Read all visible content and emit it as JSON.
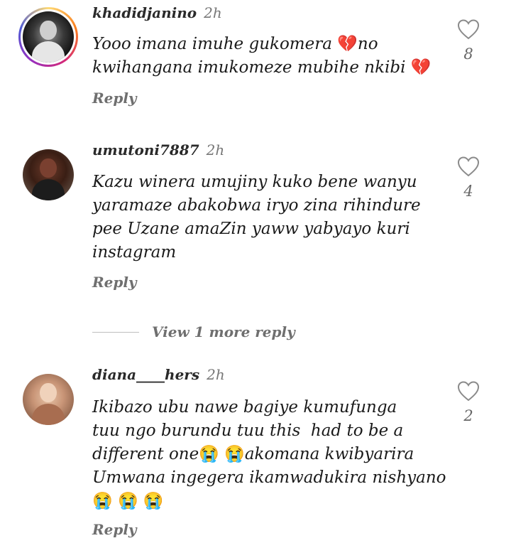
{
  "comments": [
    {
      "username": "khadidjanino",
      "time": "2h",
      "text_parts": [
        "Yooo imana imuhe gukomera ",
        "💔",
        "no\nkwihangana imukomeze mubihe nkibi ",
        "💔"
      ],
      "reply_label": "Reply",
      "likes": "8",
      "has_story_ring": true
    },
    {
      "username": "umutoni7887",
      "time": "2h",
      "text": "Kazu winera umujiny kuko bene wanyu\nyaramaze abakobwa iryo zina rihindure\npee Uzane amaZin yaww yabyayo kuri\ninstagram",
      "reply_label": "Reply",
      "likes": "4",
      "has_story_ring": false
    },
    {
      "username": "diana____hers",
      "time": "2h",
      "text_parts": [
        "Ikibazo ubu nawe bagiye kumufunga\ntuu ngo burundu tuu this  had to be a\ndifferent one",
        "😭",
        " ",
        "😭",
        "akomana kwibyarira\nUmwana ingegera ikamwadukira nishyano\n",
        "😭",
        " ",
        "😭",
        " ",
        "😭"
      ],
      "reply_label": "Reply",
      "likes": "2",
      "has_story_ring": false
    }
  ],
  "view_more": "View 1 more reply",
  "colors": {
    "broken_heart": "#d81b2e",
    "crying_face": "#3a55d6",
    "story_ring": [
      "#feda75",
      "#fa7e1e",
      "#d62976",
      "#962fbf",
      "#4f5bd5"
    ]
  },
  "icons": {
    "like": "heart-outline-icon",
    "broken_heart": "broken-heart-emoji",
    "crying": "crying-face-emoji"
  }
}
